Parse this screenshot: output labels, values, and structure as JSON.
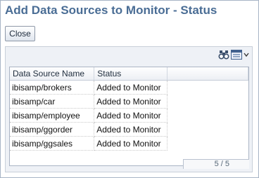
{
  "dialog": {
    "title": "Add Data Sources to Monitor - Status",
    "close_label": "Close"
  },
  "toolbar": {
    "icons": [
      "binoculars-icon",
      "grid-options-icon",
      "chevron-down-icon"
    ]
  },
  "table": {
    "columns": [
      "Data Source Name",
      "Status"
    ],
    "rows": [
      [
        "ibisamp/brokers",
        "Added to Monitor"
      ],
      [
        "ibisamp/car",
        "Added to Monitor"
      ],
      [
        "ibisamp/employee",
        "Added to Monitor"
      ],
      [
        "ibisamp/ggorder",
        "Added to Monitor"
      ],
      [
        "ibisamp/ggsales",
        "Added to Monitor"
      ]
    ]
  },
  "pagination": {
    "text": "5 / 5"
  }
}
